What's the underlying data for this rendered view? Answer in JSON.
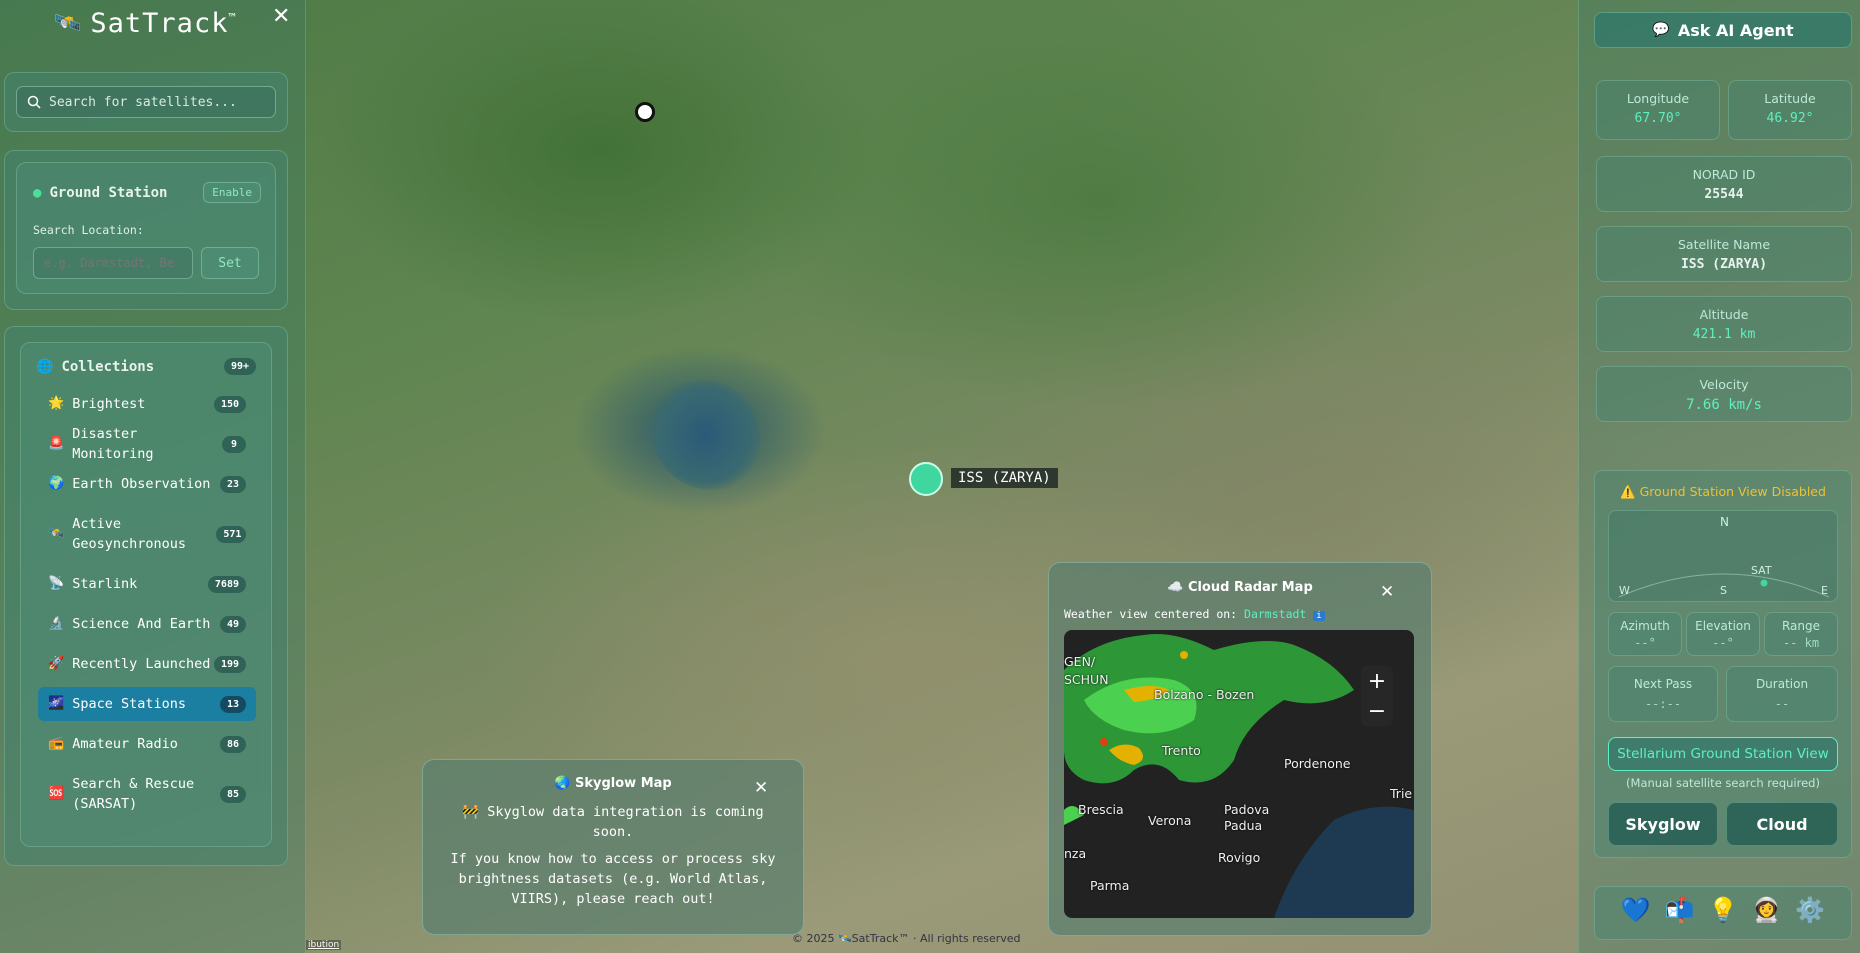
{
  "app": {
    "name": "SatTrack",
    "trademark": "™"
  },
  "search": {
    "placeholder": "Search for satellites..."
  },
  "ground_station": {
    "title": "Ground Station",
    "toggle": "Enable",
    "search_label": "Search Location:",
    "placeholder": "e.g. Darmstadt, Be",
    "set_button": "Set"
  },
  "collections": {
    "title": "Collections",
    "count": "99+",
    "items": [
      {
        "icon": "🌟",
        "label": "Brightest",
        "count": "150"
      },
      {
        "icon": "🚨",
        "label": "Disaster Monitoring",
        "count": "9"
      },
      {
        "icon": "🌍",
        "label": "Earth Observation",
        "count": "23"
      },
      {
        "icon": "🛰️",
        "label": "Active Geosynchronous",
        "count": "571"
      },
      {
        "icon": "📡",
        "label": "Starlink",
        "count": "7689"
      },
      {
        "icon": "🔬",
        "label": "Science And Earth",
        "count": "49"
      },
      {
        "icon": "🚀",
        "label": "Recently Launched",
        "count": "199"
      },
      {
        "icon": "🌌",
        "label": "Space Stations",
        "count": "13",
        "active": true
      },
      {
        "icon": "📻",
        "label": "Amateur Radio",
        "count": "86"
      },
      {
        "icon": "🆘",
        "label": "Search & Rescue (SARSAT)",
        "count": "85"
      }
    ]
  },
  "map": {
    "satellite_label": "ISS (ZARYA)",
    "attribution": "ibution",
    "footer": "© 2025 🛰️SatTrack™ · All rights reserved"
  },
  "right": {
    "ai_button": "Ask AI Agent",
    "longitude": {
      "label": "Longitude",
      "value": "67.70°"
    },
    "latitude": {
      "label": "Latitude",
      "value": "46.92°"
    },
    "norad": {
      "label": "NORAD ID",
      "value": "25544"
    },
    "sat_name": {
      "label": "Satellite Name",
      "value": "ISS (ZARYA)"
    },
    "altitude": {
      "label": "Altitude",
      "value": "421.1 km"
    },
    "velocity": {
      "label": "Velocity",
      "value": "7.66 km/s"
    },
    "gs_view": {
      "warning": "Ground Station View Disabled",
      "compass": {
        "n": "N",
        "w": "W",
        "s": "S",
        "e": "E",
        "sat": "SAT"
      },
      "azimuth": {
        "label": "Azimuth",
        "value": "--°"
      },
      "elevation": {
        "label": "Elevation",
        "value": "--°"
      },
      "range": {
        "label": "Range",
        "value": "-- km"
      },
      "next_pass": {
        "label": "Next Pass",
        "value": "--:--"
      },
      "duration": {
        "label": "Duration",
        "value": "--"
      },
      "stellarium_button": "Stellarium Ground Station View",
      "stellarium_note": "(Manual satellite search required)",
      "skyglow_button": "Skyglow",
      "cloud_button": "Cloud"
    },
    "dock_icons": [
      "💙",
      "📬",
      "💡",
      "👩‍🚀",
      "⚙️"
    ]
  },
  "skyglow": {
    "title": "Skyglow Map",
    "coming": "🚧 Skyglow data integration is coming soon.",
    "body": "If you know how to access or process sky brightness datasets (e.g. World Atlas, VIIRS), please reach out!"
  },
  "cloud": {
    "title": "Cloud Radar Map",
    "centered_label": "Weather view centered on:",
    "location": "Darmstadt",
    "zoom_in": "+",
    "zoom_out": "−",
    "places": [
      "Bolzano - Bozen",
      "Trento",
      "Pordenone",
      "Brescia",
      "Verona",
      "Padova Padua",
      "Rovigo",
      "Parma",
      "nza",
      "Trie",
      "GEN/",
      "SCHUN"
    ]
  },
  "colors": {
    "accent": "#5ef0c0",
    "active_item": "#1a7fa0",
    "warning": "#f0c030",
    "cloud_dark": "#1e1e1e",
    "sea": "#1e3a52"
  }
}
